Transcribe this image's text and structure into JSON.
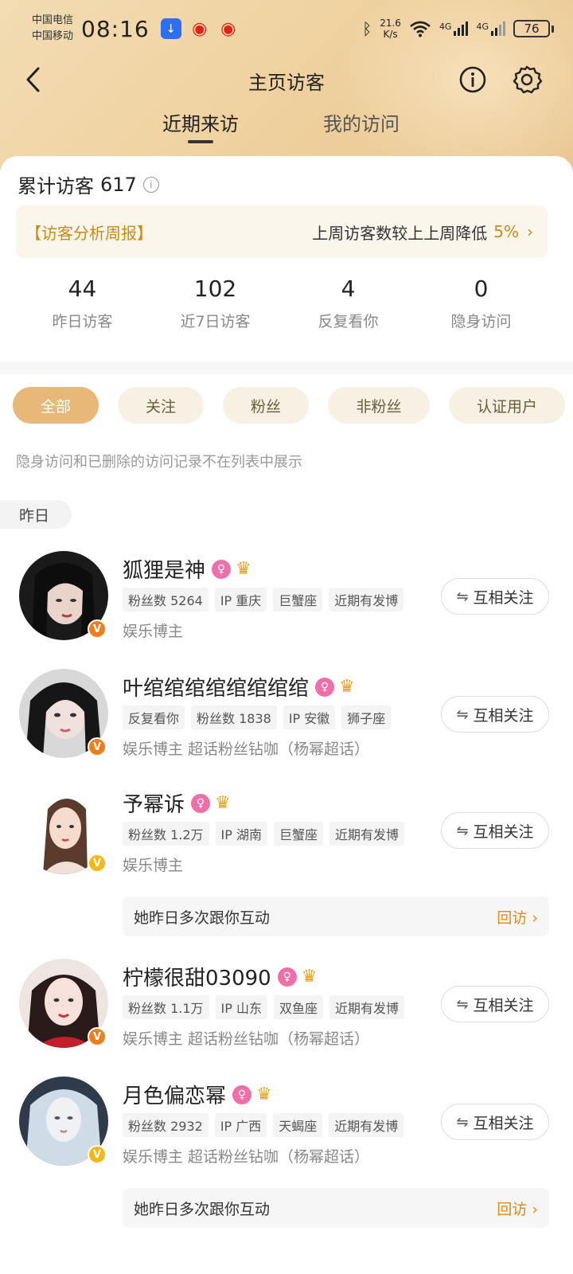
{
  "status": {
    "carrier1": "中国电信",
    "carrier2": "中国移动",
    "time": "08:16",
    "speed_value": "21.6",
    "speed_unit": "K/s",
    "net1": "4G",
    "net2": "4G",
    "battery": "76"
  },
  "nav": {
    "title": "主页访客"
  },
  "tabs": {
    "recent": "近期来访",
    "mine": "我的访问"
  },
  "summary": {
    "total_label": "累计访客",
    "total_value": "617",
    "report_tag": "【访客分析周报】",
    "report_text": "上周访客数较上上周降低",
    "report_pct": "5%",
    "stats": [
      {
        "value": "44",
        "label": "昨日访客"
      },
      {
        "value": "102",
        "label": "近7日访客"
      },
      {
        "value": "4",
        "label": "反复看你"
      },
      {
        "value": "0",
        "label": "隐身访问"
      }
    ]
  },
  "filters": [
    "全部",
    "关注",
    "粉丝",
    "非粉丝",
    "认证用户"
  ],
  "hint": "隐身访问和已删除的访问记录不在列表中展示",
  "day_label": "昨日",
  "follow_label": "互相关注",
  "visitors": [
    {
      "name": "狐狸是神",
      "tags": [
        "粉丝数 5264",
        "IP 重庆",
        "巨蟹座",
        "近期有发博"
      ],
      "desc": "娱乐博主"
    },
    {
      "name": "叶绾绾绾绾绾绾绾绾",
      "tags": [
        "反复看你",
        "粉丝数 1838",
        "IP 安徽",
        "狮子座"
      ],
      "desc": "娱乐博主 超话粉丝钻咖（杨幂超话）"
    },
    {
      "name": "予幂诉",
      "tags": [
        "粉丝数 1.2万",
        "IP 湖南",
        "巨蟹座",
        "近期有发博"
      ],
      "desc": "娱乐博主",
      "interaction": "她昨日多次跟你互动",
      "revisit": "回访 ›"
    },
    {
      "name": "柠檬很甜03090",
      "tags": [
        "粉丝数 1.1万",
        "IP 山东",
        "双鱼座",
        "近期有发博"
      ],
      "desc": "娱乐博主 超话粉丝钻咖（杨幂超话）"
    },
    {
      "name": "月色偏恋幂",
      "tags": [
        "粉丝数 2932",
        "IP 广西",
        "天蝎座",
        "近期有发博"
      ],
      "desc": "娱乐博主 超话粉丝钻咖（杨幂超话）",
      "interaction": "她昨日多次跟你互动",
      "revisit": "回访 ›"
    }
  ]
}
